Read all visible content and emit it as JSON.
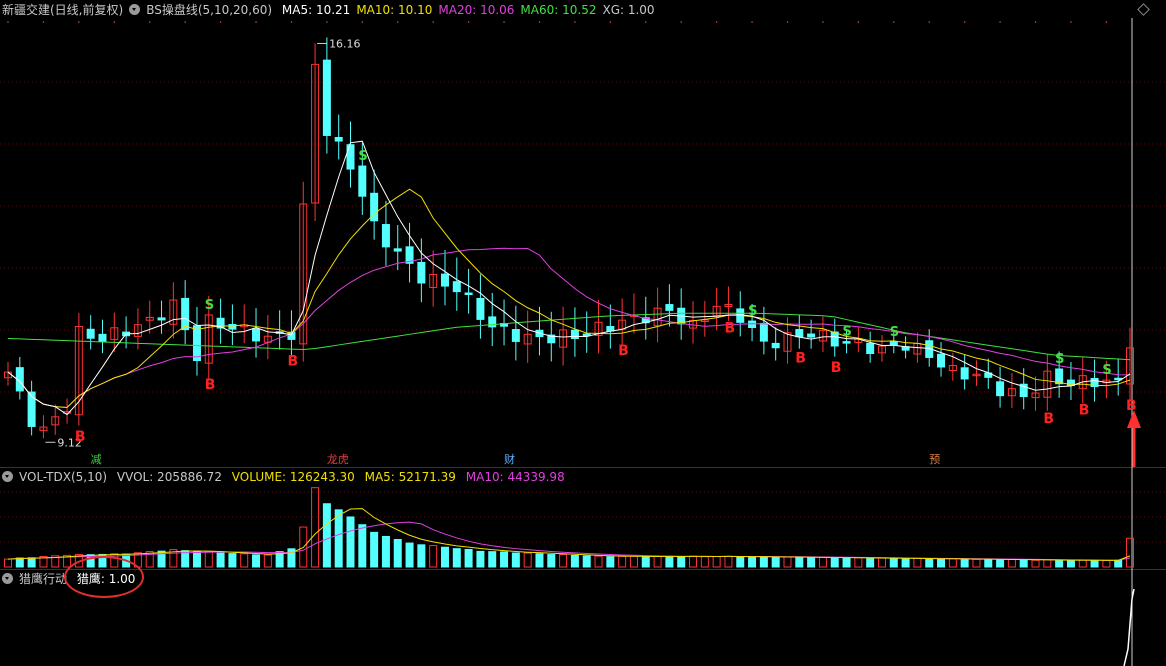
{
  "main": {
    "title": "新疆交建(日线,前复权)",
    "indicator": "BS操盘线(5,10,20,60)",
    "ma": [
      {
        "label": "MA5: 10.21",
        "color": "#ffffff"
      },
      {
        "label": "MA10: 10.10",
        "color": "#f0e000"
      },
      {
        "label": "MA20: 10.06",
        "color": "#e040e0"
      },
      {
        "label": "MA60: 10.52",
        "color": "#40e040"
      },
      {
        "label": "XG: 1.00",
        "color": "#c8c8c8"
      }
    ],
    "high_label": "16.16",
    "low_label": "9.12",
    "events": [
      {
        "text": "减",
        "color": "#40d040"
      },
      {
        "text": "龙虎",
        "color": "#e04040"
      },
      {
        "text": "财",
        "color": "#60b0ff"
      },
      {
        "text": "预",
        "color": "#e08040"
      }
    ],
    "buy_label": "B",
    "sell_label": "S"
  },
  "volume": {
    "title": "VOL-TDX(5,10)",
    "vvol": "VVOL: 205886.72",
    "volume_label": "VOLUME: 126243.30",
    "ma5": "MA5: 52171.39",
    "ma10": "MA10: 44339.98"
  },
  "indicator2": {
    "title": "猎鹰行动",
    "value_label": "猎鹰: 1.00"
  },
  "colors": {
    "up": "#ff3232",
    "down": "#54ffff",
    "ma5": "#ffffff",
    "ma10": "#f0e000",
    "ma20": "#e040e0",
    "ma60": "#40e040",
    "arrow": "#ff3030"
  },
  "chart_data": {
    "type": "candlestick",
    "y_range": [
      9.12,
      16.16
    ],
    "events": [
      {
        "label": "减",
        "index": 7
      },
      {
        "label": "龙虎",
        "index": 27
      },
      {
        "label": "财",
        "index": 42
      },
      {
        "label": "预",
        "index": 78
      }
    ],
    "keyframes": [
      {
        "i": 0,
        "c": 10.3
      },
      {
        "i": 2,
        "c": 9.45
      },
      {
        "i": 3,
        "c": 9.25
      },
      {
        "i": 5,
        "c": 9.7
      },
      {
        "i": 6,
        "c": 11.0
      },
      {
        "i": 8,
        "c": 10.9
      },
      {
        "i": 12,
        "c": 11.2
      },
      {
        "i": 14,
        "c": 11.5
      },
      {
        "i": 16,
        "c": 10.6
      },
      {
        "i": 17,
        "c": 11.2
      },
      {
        "i": 19,
        "c": 11.1
      },
      {
        "i": 22,
        "c": 10.9
      },
      {
        "i": 24,
        "c": 11.0
      },
      {
        "i": 25,
        "c": 13.2
      },
      {
        "i": 26,
        "c": 15.8
      },
      {
        "i": 27,
        "c": 14.6
      },
      {
        "i": 29,
        "c": 14.0
      },
      {
        "i": 31,
        "c": 12.9
      },
      {
        "i": 33,
        "c": 12.4
      },
      {
        "i": 35,
        "c": 12.0
      },
      {
        "i": 38,
        "c": 11.8
      },
      {
        "i": 41,
        "c": 11.1
      },
      {
        "i": 44,
        "c": 10.9
      },
      {
        "i": 48,
        "c": 10.95
      },
      {
        "i": 52,
        "c": 11.2
      },
      {
        "i": 56,
        "c": 11.4
      },
      {
        "i": 58,
        "c": 11.1
      },
      {
        "i": 60,
        "c": 11.5
      },
      {
        "i": 62,
        "c": 11.3
      },
      {
        "i": 64,
        "c": 10.8
      },
      {
        "i": 66,
        "c": 10.9
      },
      {
        "i": 68,
        "c": 11.0
      },
      {
        "i": 70,
        "c": 10.85
      },
      {
        "i": 72,
        "c": 10.8
      },
      {
        "i": 74,
        "c": 10.7
      },
      {
        "i": 76,
        "c": 10.8
      },
      {
        "i": 78,
        "c": 10.6
      },
      {
        "i": 80,
        "c": 10.3
      },
      {
        "i": 82,
        "c": 10.25
      },
      {
        "i": 84,
        "c": 10.0
      },
      {
        "i": 86,
        "c": 9.85
      },
      {
        "i": 88,
        "c": 10.2
      },
      {
        "i": 90,
        "c": 10.1
      },
      {
        "i": 92,
        "c": 10.15
      },
      {
        "i": 94,
        "c": 10.1
      },
      {
        "i": 95,
        "c": 10.85
      }
    ],
    "buys": [
      6,
      17,
      24,
      52,
      61,
      67,
      70,
      88,
      91,
      95
    ],
    "sells": [
      17,
      30,
      63,
      71,
      75,
      89,
      93
    ],
    "ma5": 10.21,
    "ma10": 10.1,
    "ma20": 10.06,
    "ma60": 10.52,
    "volume": {
      "keyframes": [
        {
          "i": 0,
          "v": 6
        },
        {
          "i": 5,
          "v": 9
        },
        {
          "i": 10,
          "v": 10
        },
        {
          "i": 14,
          "v": 13
        },
        {
          "i": 17,
          "v": 11
        },
        {
          "i": 22,
          "v": 9
        },
        {
          "i": 24,
          "v": 14
        },
        {
          "i": 25,
          "v": 30
        },
        {
          "i": 26,
          "v": 60
        },
        {
          "i": 27,
          "v": 48
        },
        {
          "i": 29,
          "v": 38
        },
        {
          "i": 31,
          "v": 26
        },
        {
          "i": 34,
          "v": 18
        },
        {
          "i": 40,
          "v": 12
        },
        {
          "i": 50,
          "v": 8
        },
        {
          "i": 60,
          "v": 8
        },
        {
          "i": 70,
          "v": 7
        },
        {
          "i": 80,
          "v": 6
        },
        {
          "i": 90,
          "v": 5
        },
        {
          "i": 94,
          "v": 5
        },
        {
          "i": 95,
          "v": 22
        }
      ],
      "vvol": 205886.72,
      "volume": 126243.3,
      "ma5": 52171.39,
      "ma10": 44339.98
    },
    "indicator": {
      "name": "猎鹰",
      "value": 1.0
    }
  }
}
